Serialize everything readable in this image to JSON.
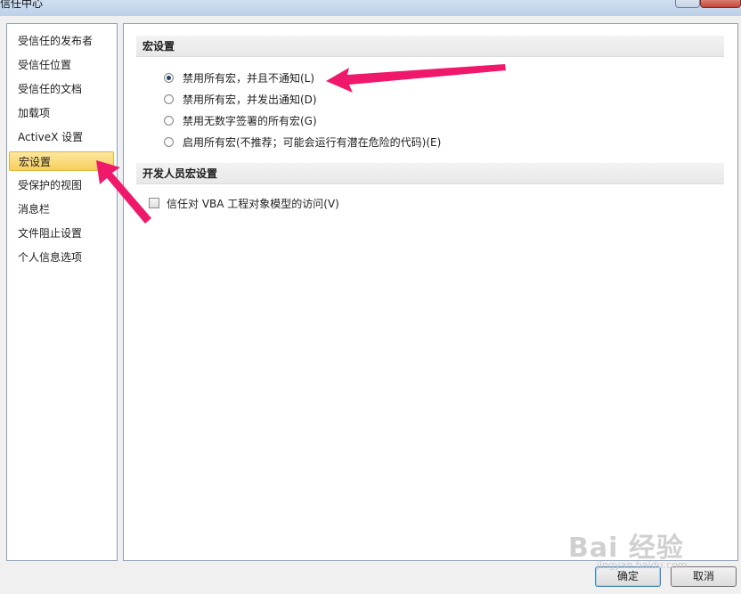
{
  "window": {
    "title": "信任中心"
  },
  "sidebar": {
    "items": [
      {
        "label": "受信任的发布者",
        "selected": false
      },
      {
        "label": "受信任位置",
        "selected": false
      },
      {
        "label": "受信任的文档",
        "selected": false
      },
      {
        "label": "加载项",
        "selected": false
      },
      {
        "label": "ActiveX 设置",
        "selected": false
      },
      {
        "label": "宏设置",
        "selected": true
      },
      {
        "label": "受保护的视图",
        "selected": false
      },
      {
        "label": "消息栏",
        "selected": false
      },
      {
        "label": "文件阻止设置",
        "selected": false
      },
      {
        "label": "个人信息选项",
        "selected": false
      }
    ]
  },
  "macro_settings": {
    "header": "宏设置",
    "options": [
      {
        "label": "禁用所有宏，并且不通知(L)",
        "checked": true
      },
      {
        "label": "禁用所有宏，并发出通知(D)",
        "checked": false
      },
      {
        "label": "禁用无数字签署的所有宏(G)",
        "checked": false
      },
      {
        "label": "启用所有宏(不推荐；可能会运行有潜在危险的代码)(E)",
        "checked": false
      }
    ]
  },
  "developer_settings": {
    "header": "开发人员宏设置",
    "vba_access_label": "信任对 VBA 工程对象模型的访问(V)",
    "vba_access_checked": false
  },
  "buttons": {
    "ok": "确定",
    "cancel": "取消"
  },
  "watermark": {
    "text": "Bai 经验",
    "subtext": "jingyan.baidu.com"
  },
  "colors": {
    "arrow": "#f0186a",
    "selection": "#f7cf5b"
  }
}
